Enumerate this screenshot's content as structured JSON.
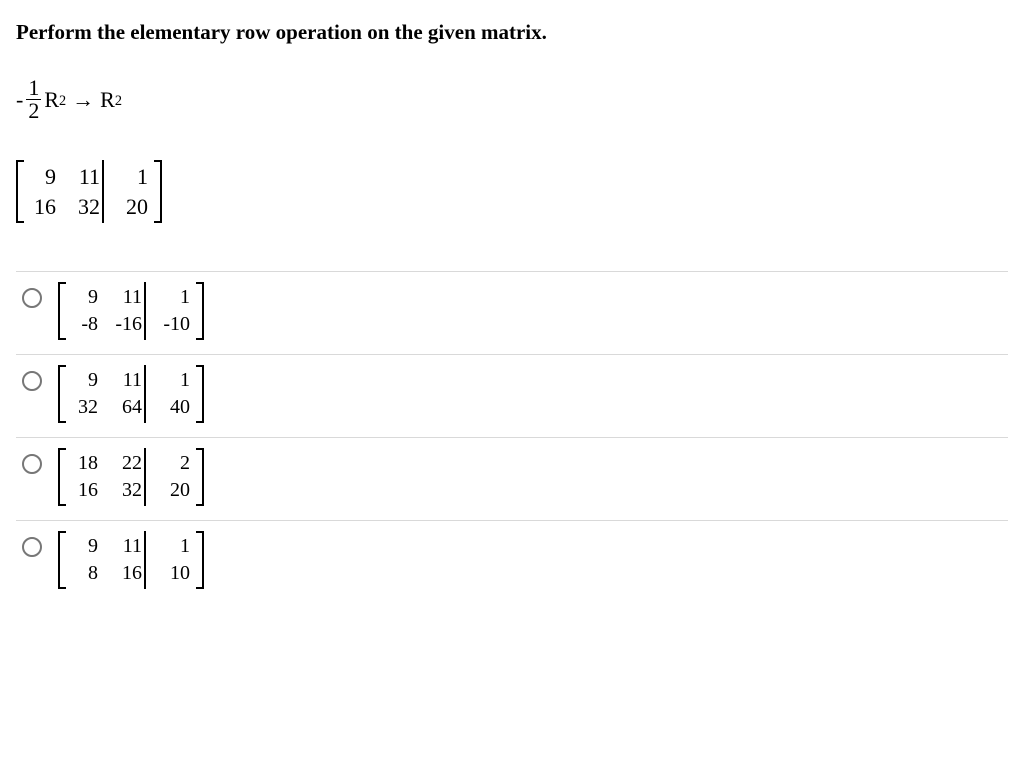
{
  "question": "Perform the elementary row operation on the given matrix.",
  "operation": {
    "minus": "-",
    "frac_num": "1",
    "frac_den": "2",
    "R": "R",
    "sub2a": "2",
    "arrow": "→",
    "R2": "R",
    "sub2b": "2"
  },
  "given": {
    "r1c1": "9",
    "r1c2": "11",
    "r1c3": "1",
    "r2c1": "16",
    "r2c2": "32",
    "r2c3": "20"
  },
  "choices": [
    {
      "r1c1": "9",
      "r1c2": "11",
      "r1c3": "1",
      "r2c1": "-8",
      "r2c2": "-16",
      "r2c3": "-10"
    },
    {
      "r1c1": "9",
      "r1c2": "11",
      "r1c3": "1",
      "r2c1": "32",
      "r2c2": "64",
      "r2c3": "40"
    },
    {
      "r1c1": "18",
      "r1c2": "22",
      "r1c3": "2",
      "r2c1": "16",
      "r2c2": "32",
      "r2c3": "20"
    },
    {
      "r1c1": "9",
      "r1c2": "11",
      "r1c3": "1",
      "r2c1": "8",
      "r2c2": "16",
      "r2c3": "10"
    }
  ]
}
